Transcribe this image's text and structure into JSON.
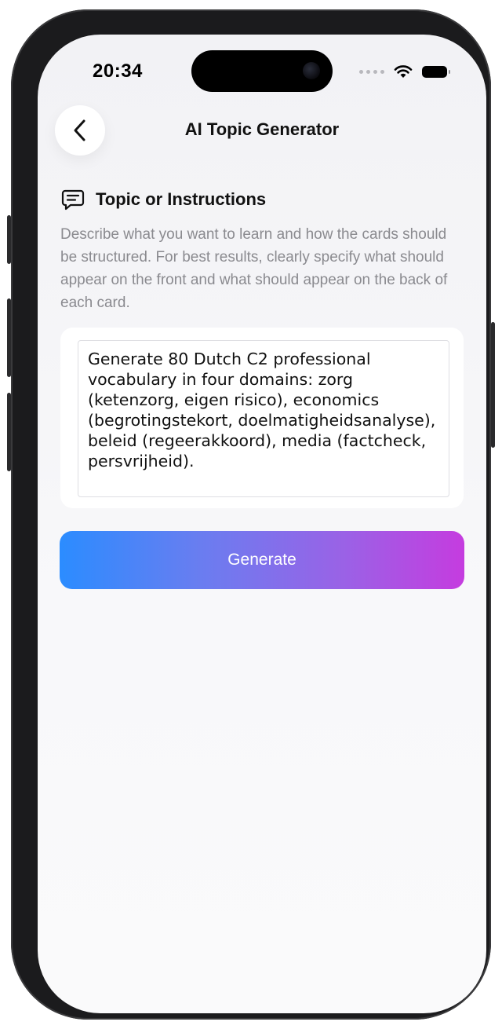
{
  "status_bar": {
    "time": "20:34"
  },
  "nav": {
    "title": "AI Topic Generator",
    "back_icon": "chevron-left-icon"
  },
  "section": {
    "icon": "message-lines-icon",
    "title": "Topic or Instructions",
    "description": "Describe what you want to learn and how the cards should be structured. For best results, clearly specify what should appear on the front and what should appear on the back of each card."
  },
  "prompt_input": {
    "value": "Generate 80 Dutch C2 professional vocabulary in four domains: zorg (ketenzorg, eigen risico), economics (begrotingstekort, doelmatigheidsanalyse), beleid (regeerakkoord), media (factcheck, persvrijheid)."
  },
  "generate_button": {
    "label": "Generate",
    "gradient_start": "#2b8cff",
    "gradient_end": "#c53cdf"
  }
}
